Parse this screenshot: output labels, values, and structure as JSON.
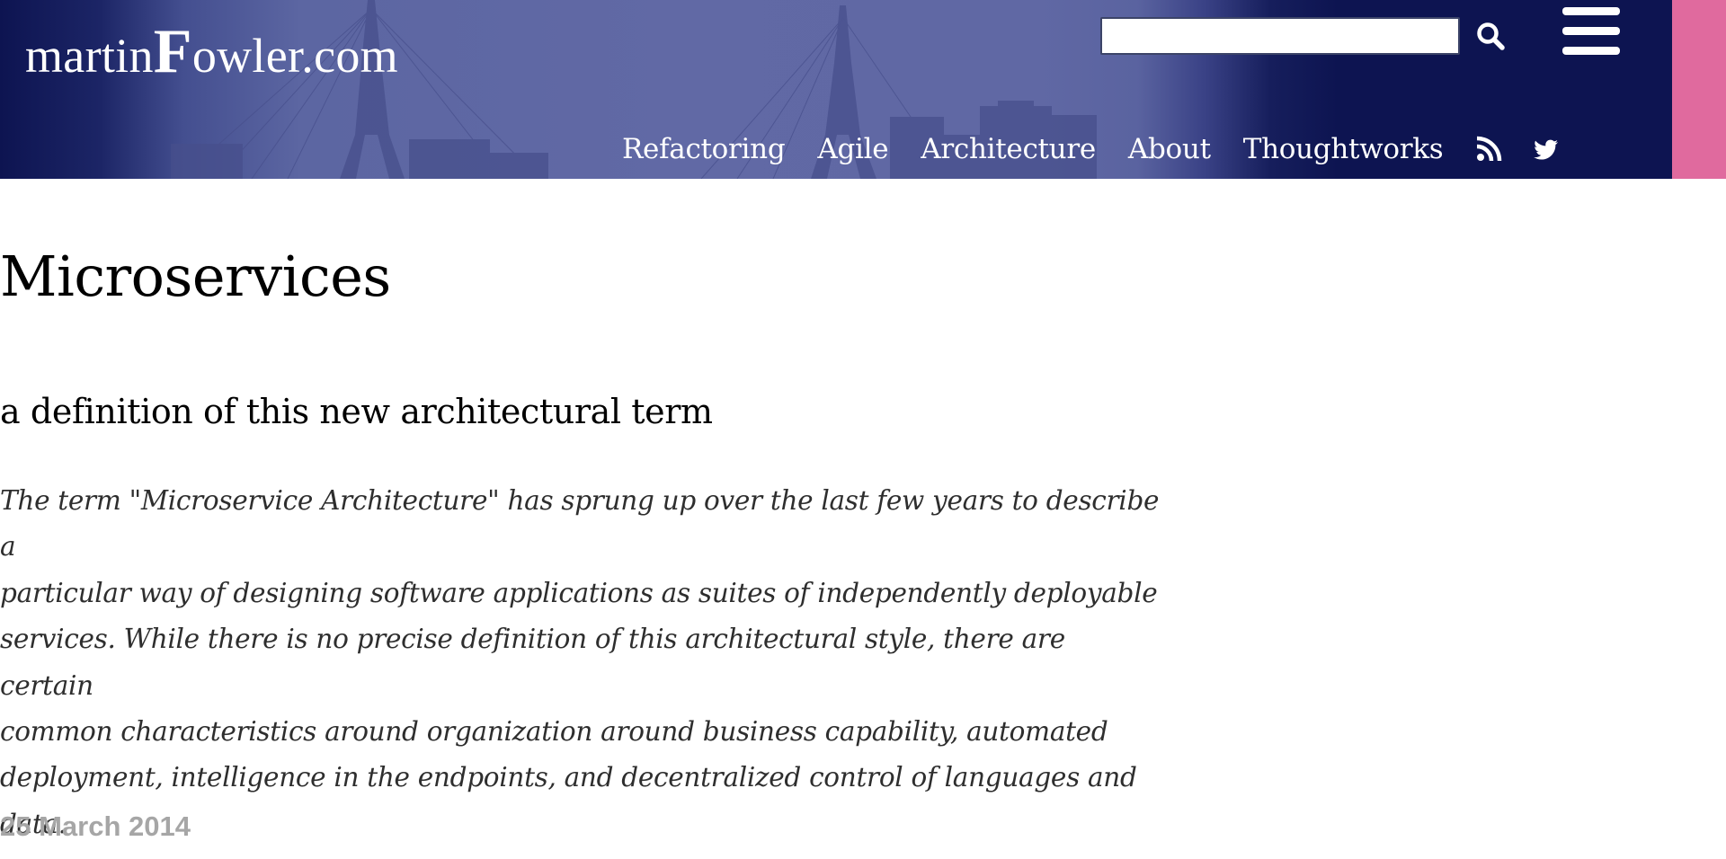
{
  "header": {
    "logo_prefix": "martin",
    "logo_initial": "F",
    "logo_suffix": "owler.com",
    "search_placeholder": "",
    "search_icon": "search-icon",
    "menu_icon": "hamburger-menu-icon",
    "nav": [
      {
        "label": "Refactoring"
      },
      {
        "label": "Agile"
      },
      {
        "label": "Architecture"
      },
      {
        "label": "About"
      },
      {
        "label": "Thoughtworks"
      }
    ],
    "social": [
      {
        "icon": "rss-icon"
      },
      {
        "icon": "twitter-icon"
      }
    ]
  },
  "article": {
    "title": "Microservices",
    "subtitle": "a definition of this new architectural term",
    "abstract_lines": [
      "The term \"Microservice Architecture\" has sprung up over the last few years to describe a",
      "particular way of designing software applications as suites of independently deployable",
      "services. While there is no precise definition of this architectural style, there are certain",
      "common characteristics around organization around business capability, automated",
      "deployment, intelligence in the endpoints, and decentralized control of languages and",
      "data."
    ],
    "date": "25 March 2014"
  },
  "colors": {
    "header_background": "#0d1451",
    "banner_tint": "#6169a5",
    "accent_stripe": "#e06a9e",
    "date_gray": "#a6a6a6"
  }
}
